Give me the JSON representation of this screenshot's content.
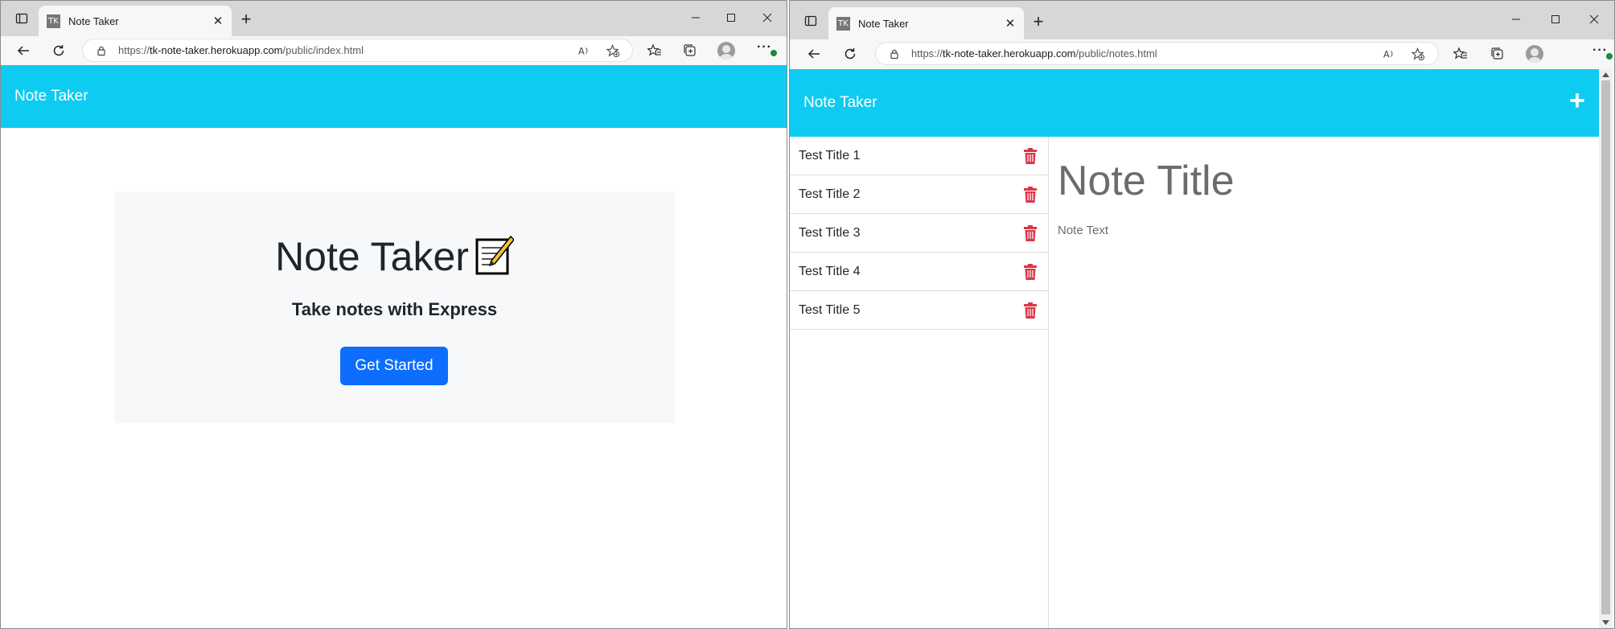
{
  "left_window": {
    "tab": {
      "favicon": "TK",
      "title": "Note Taker",
      "close": "✕"
    },
    "new_tab": "+",
    "address": {
      "scheme": "https://",
      "host": "tk-note-taker.herokuapp.com",
      "path": "/public/index.html"
    },
    "page": {
      "brand": "Note Taker",
      "heading": "Note Taker",
      "subheading": "Take notes with Express",
      "cta_label": "Get Started"
    }
  },
  "right_window": {
    "tab": {
      "favicon": "TK",
      "title": "Note Taker",
      "close": "✕"
    },
    "new_tab": "+",
    "address": {
      "scheme": "https://",
      "host": "tk-note-taker.herokuapp.com",
      "path": "/public/notes.html"
    },
    "page": {
      "brand": "Note Taker",
      "new_note_glyph": "+",
      "notes": [
        {
          "title": "Test Title 1"
        },
        {
          "title": "Test Title 2"
        },
        {
          "title": "Test Title 3"
        },
        {
          "title": "Test Title 4"
        },
        {
          "title": "Test Title 5"
        }
      ],
      "editor": {
        "title_placeholder": "Note Title",
        "text_placeholder": "Note Text"
      }
    }
  },
  "theme": {
    "navbar": "#0ecbf1",
    "primary_button": "#0d6efd",
    "trash": "#dc3545",
    "jumbotron": "#f7f8fa"
  },
  "icons": [
    "workspaces-icon",
    "back-icon",
    "refresh-icon",
    "lock-icon",
    "read-aloud-icon",
    "add-favorite-icon",
    "favorites-icon",
    "collections-icon",
    "profile-icon",
    "more-icon",
    "trash-icon",
    "plus-icon",
    "memo-icon"
  ]
}
